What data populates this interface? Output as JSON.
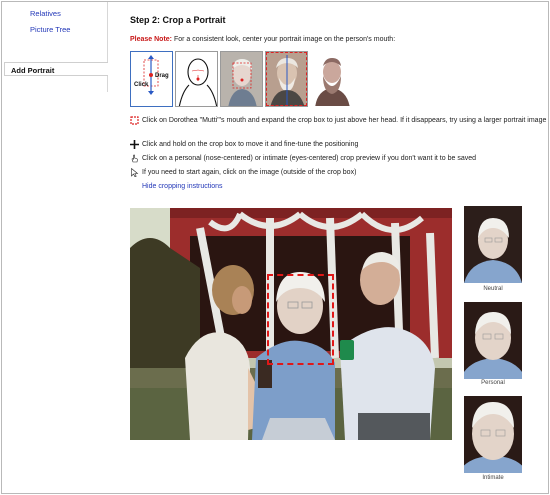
{
  "sidebar": {
    "links": [
      "Relatives",
      "Picture Tree"
    ],
    "active_tab": "Add Portrait"
  },
  "main": {
    "title": "Step 2: Crop a Portrait",
    "note_label": "Please Note:",
    "note_text": " For a consistent look, center your portrait image on the person's mouth:",
    "guide": {
      "drag_label": "Drag",
      "click_label": "Click"
    },
    "instructions": [
      {
        "icon": "crop-box-icon",
        "text": "Click on Dorothea \"Mutti\"'s mouth and expand the crop box to just above her head. If it disappears, try using a larger portrait image"
      },
      {
        "icon": "move-cross-icon",
        "text": "Click and hold on the crop box to move it and fine-tune the positioning"
      },
      {
        "icon": "hand-pointer-icon",
        "text": "Click on a personal (nose-centered) or intimate (eyes-centered) crop preview if you don't want it to be saved"
      },
      {
        "icon": "arrow-pointer-icon",
        "text": "If you need to start again, click on the image (outside of the crop box)"
      }
    ],
    "hide_link": "Hide cropping instructions",
    "previews": [
      "Neutral",
      "Personal",
      "Intimate"
    ]
  },
  "colors": {
    "link": "#2338b8",
    "note_red": "#c81717",
    "crop_red": "#e01818"
  }
}
